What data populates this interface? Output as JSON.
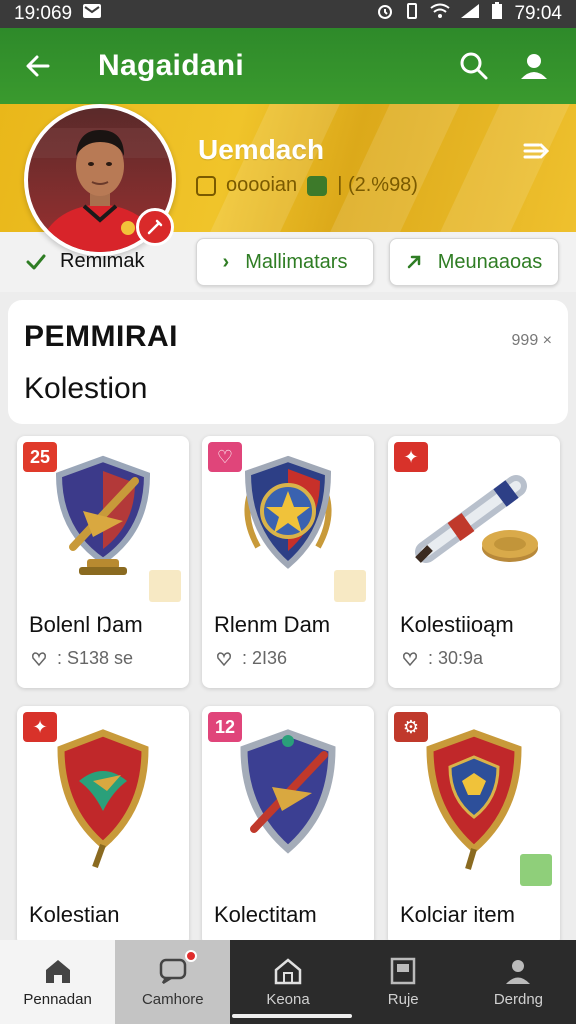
{
  "status_bar": {
    "left_time": "19:069",
    "right_time": "79:04"
  },
  "app_bar": {
    "title": "Nagaidani"
  },
  "profile": {
    "name": "Uemdach",
    "stats_text": "ooooian",
    "stats_value": "| (2.%98)",
    "verified_label": "Remimak"
  },
  "actions": [
    {
      "label": "Mallimatars"
    },
    {
      "label": "Meunaaoas"
    }
  ],
  "collection": {
    "title": "PEMMIRAI",
    "subtitle": "Kolestion",
    "count": "999 ×"
  },
  "items": [
    {
      "badge": "25",
      "badge_color": "#e03a2a",
      "name": "Bolenl Ŋam",
      "meta": ": S138 se"
    },
    {
      "badge": "♡",
      "badge_color": "#e0457a",
      "name": "Rlenm Dam",
      "meta": ": 2I36"
    },
    {
      "badge": "✦",
      "badge_color": "#d8322a",
      "name": "Kolestiioąm",
      "meta": ": 30:9a"
    },
    {
      "badge": "✦",
      "badge_color": "#d8322a",
      "name": "Kolestian",
      "meta": ""
    },
    {
      "badge": "12",
      "badge_color": "#e0457a",
      "name": "Kolectitam",
      "meta": ""
    },
    {
      "badge": "⚙",
      "badge_color": "#c0392b",
      "name": "Kolciar item",
      "meta": ""
    }
  ],
  "bottom_nav": [
    {
      "label": "Pennadan",
      "icon": "home-icon"
    },
    {
      "label": "Camhore",
      "icon": "chat-icon"
    },
    {
      "label": "Keona",
      "icon": "house-outline-icon"
    },
    {
      "label": "Ruje",
      "icon": "document-icon"
    },
    {
      "label": "Derdng",
      "icon": "person-icon"
    }
  ],
  "colors": {
    "primary": "#2e8a2a",
    "banner": "#efc12e",
    "accent_green": "#2f7d24"
  }
}
